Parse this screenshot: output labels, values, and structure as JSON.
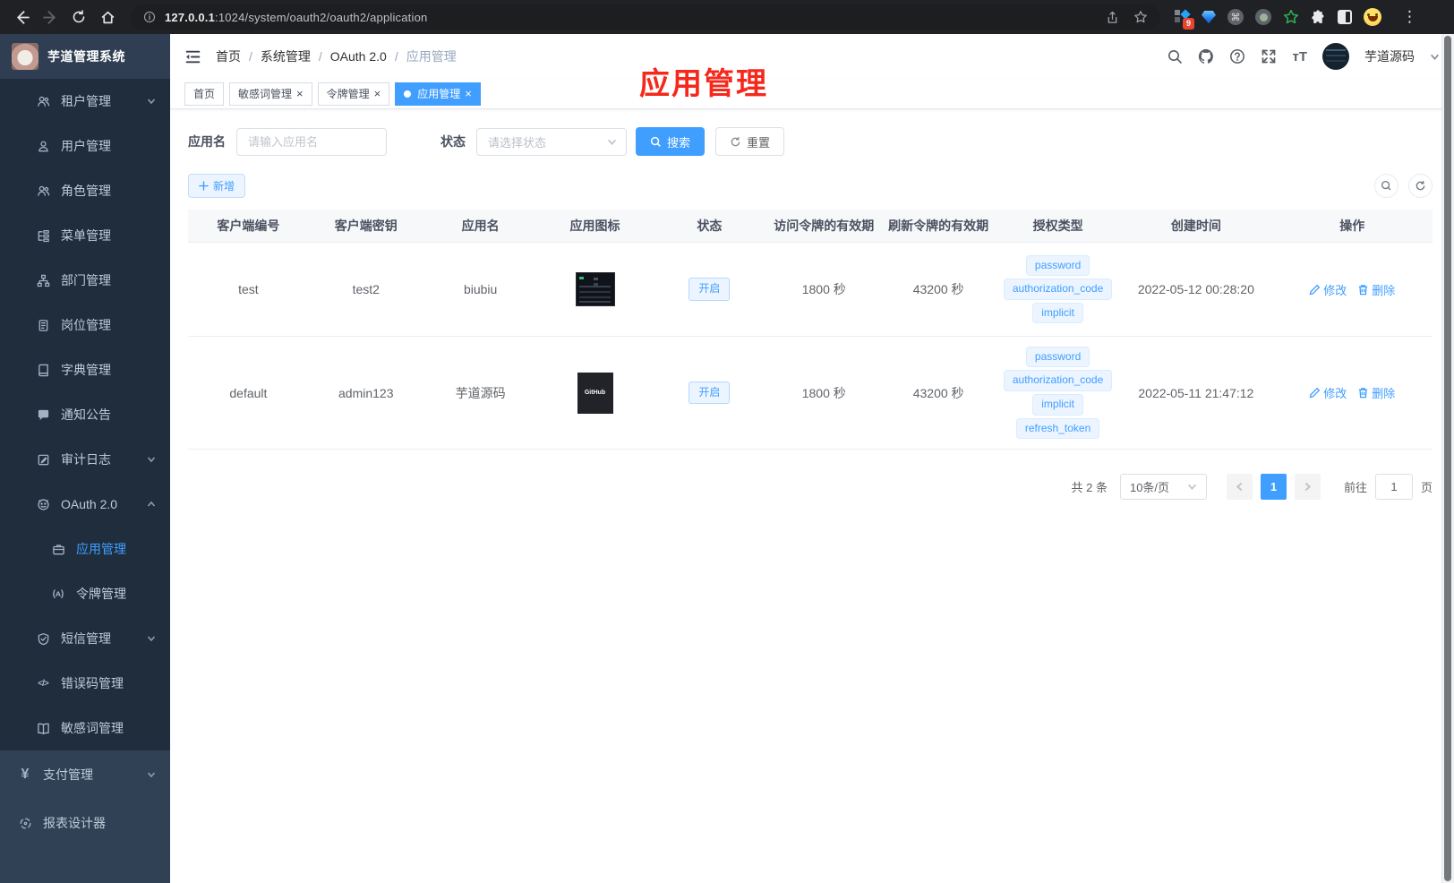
{
  "browser": {
    "url_host": "127.0.0.1",
    "url_rest": ":1024/system/oauth2/oauth2/application",
    "ext_badge": "9"
  },
  "colors": {
    "accent": "#409eff",
    "annotation_red": "#f6281b",
    "sidebar_bg": "#304156",
    "submenu_bg": "#1f2d3d",
    "tag_bg": "#ecf5ff"
  },
  "sidebar": {
    "logo_title": "芋道管理系统",
    "items": [
      {
        "label": "租户管理"
      },
      {
        "label": "用户管理"
      },
      {
        "label": "角色管理"
      },
      {
        "label": "菜单管理"
      },
      {
        "label": "部门管理"
      },
      {
        "label": "岗位管理"
      },
      {
        "label": "字典管理"
      },
      {
        "label": "通知公告"
      },
      {
        "label": "审计日志"
      },
      {
        "label": "OAuth 2.0"
      },
      {
        "label": "应用管理"
      },
      {
        "label": "令牌管理"
      },
      {
        "label": "短信管理"
      },
      {
        "label": "错误码管理"
      },
      {
        "label": "敏感词管理"
      },
      {
        "label": "支付管理"
      },
      {
        "label": "报表设计器"
      }
    ]
  },
  "header": {
    "breadcrumbs": [
      "首页",
      "系统管理",
      "OAuth 2.0",
      "应用管理"
    ],
    "username": "芋道源码",
    "annotation": "应用管理"
  },
  "tabs": [
    {
      "label": "首页"
    },
    {
      "label": "敏感词管理"
    },
    {
      "label": "令牌管理"
    },
    {
      "label": "应用管理"
    }
  ],
  "filters": {
    "name_label": "应用名",
    "name_placeholder": "请输入应用名",
    "status_label": "状态",
    "status_placeholder": "请选择状态",
    "search_label": "搜索",
    "reset_label": "重置",
    "add_label": "新增"
  },
  "table": {
    "headers": [
      "客户端编号",
      "客户端密钥",
      "应用名",
      "应用图标",
      "状态",
      "访问令牌的有效期",
      "刷新令牌的有效期",
      "授权类型",
      "创建时间",
      "操作"
    ],
    "edit_label": "修改",
    "delete_label": "删除",
    "rows": [
      {
        "client_id": "test",
        "secret": "test2",
        "name": "biubiu",
        "status": "开启",
        "access_ttl": "1800 秒",
        "refresh_ttl": "43200 秒",
        "grants": [
          "password",
          "authorization_code",
          "implicit"
        ],
        "created": "2022-05-12 00:28:20"
      },
      {
        "client_id": "default",
        "secret": "admin123",
        "name": "芋道源码",
        "icon_text": "GitHub",
        "status": "开启",
        "access_ttl": "1800 秒",
        "refresh_ttl": "43200 秒",
        "grants": [
          "password",
          "authorization_code",
          "implicit",
          "refresh_token"
        ],
        "created": "2022-05-11 21:47:12"
      }
    ]
  },
  "pagination": {
    "total": "共 2 条",
    "page_size": "10条/页",
    "current_page": "1",
    "goto_label": "前往",
    "goto_value": "1",
    "page_unit": "页"
  }
}
